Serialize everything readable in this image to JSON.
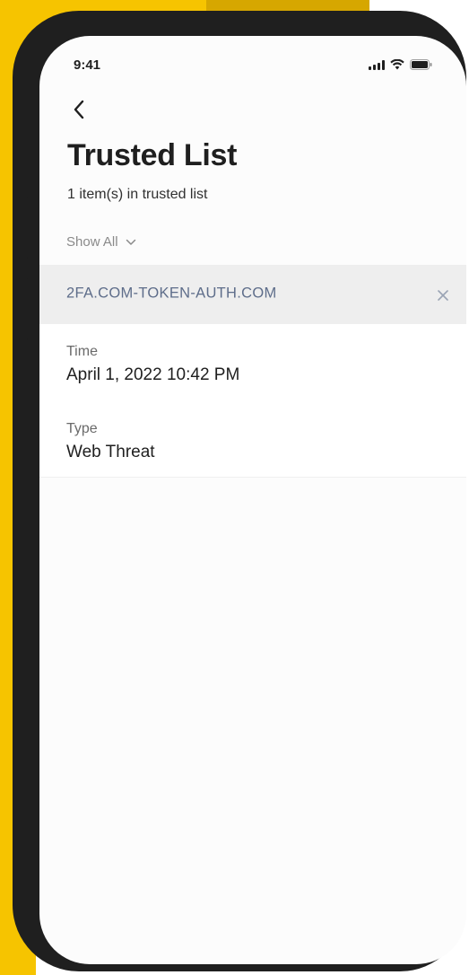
{
  "status_bar": {
    "time": "9:41"
  },
  "icons": {
    "back": "chevron-left-icon",
    "filter_toggle": "chevron-down-icon",
    "remove": "close-icon",
    "signal": "cellular-signal-icon",
    "wifi": "wifi-icon",
    "battery": "battery-icon"
  },
  "header": {
    "title": "Trusted List",
    "subtitle": "1 item(s) in trusted list"
  },
  "filter": {
    "label": "Show All"
  },
  "items": [
    {
      "url": "2FA.COM-TOKEN-AUTH.COM",
      "time_label": "Time",
      "time_value": "April 1, 2022 10:42 PM",
      "type_label": "Type",
      "type_value": "Web Threat"
    }
  ],
  "colors": {
    "brand_yellow": "#f6c400",
    "phone_frame": "#1f1f1f",
    "url_text": "#5e6d8a",
    "item_header_bg": "#eeeeee"
  }
}
